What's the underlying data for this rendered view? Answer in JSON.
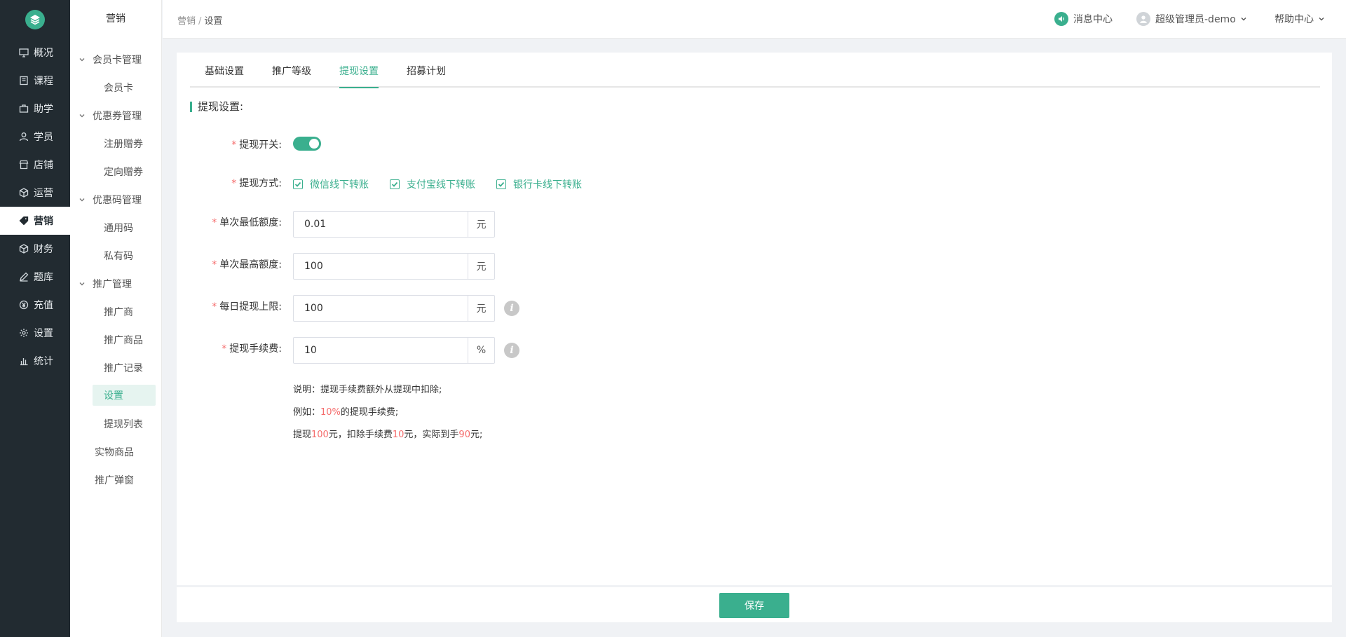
{
  "rail": {
    "items": [
      {
        "label": "概况",
        "icon": "monitor-icon"
      },
      {
        "label": "课程",
        "icon": "book-icon"
      },
      {
        "label": "助学",
        "icon": "briefcase-icon"
      },
      {
        "label": "学员",
        "icon": "user-icon"
      },
      {
        "label": "店铺",
        "icon": "store-icon"
      },
      {
        "label": "运营",
        "icon": "cube-icon"
      },
      {
        "label": "营销",
        "icon": "tag-icon",
        "active": true
      },
      {
        "label": "财务",
        "icon": "cube-icon"
      },
      {
        "label": "题库",
        "icon": "pen-icon"
      },
      {
        "label": "充值",
        "icon": "yen-icon"
      },
      {
        "label": "设置",
        "icon": "gear-icon"
      },
      {
        "label": "统计",
        "icon": "bar-chart-icon"
      }
    ]
  },
  "sidebar": {
    "title": "营销",
    "groups": [
      {
        "label": "会员卡管理",
        "items": [
          "会员卡"
        ]
      },
      {
        "label": "优惠券管理",
        "items": [
          "注册赠券",
          "定向赠券"
        ]
      },
      {
        "label": "优惠码管理",
        "items": [
          "通用码",
          "私有码"
        ]
      },
      {
        "label": "推广管理",
        "items": [
          "推广商",
          "推广商品",
          "推广记录",
          "设置",
          "提现列表"
        ]
      }
    ],
    "plain": [
      "实物商品",
      "推广弹窗"
    ]
  },
  "header": {
    "breadcrumb": [
      "营销",
      "设置"
    ],
    "messages": "消息中心",
    "user": "超级管理员-demo",
    "help": "帮助中心"
  },
  "tabs": [
    "基础设置",
    "推广等级",
    "提现设置",
    "招募计划"
  ],
  "active_tab": "提现设置",
  "form": {
    "section_title": "提现设置:",
    "switch_label": "提现开关:",
    "switch_on": true,
    "method_label": "提现方式:",
    "methods": [
      "微信线下转账",
      "支付宝线下转账",
      "银行卡线下转账"
    ],
    "min_label": "单次最低额度:",
    "min_value": "0.01",
    "min_unit": "元",
    "max_label": "单次最高额度:",
    "max_value": "100",
    "max_unit": "元",
    "daily_label": "每日提现上限:",
    "daily_value": "100",
    "daily_unit": "元",
    "fee_label": "提现手续费:",
    "fee_value": "10",
    "fee_unit": "%"
  },
  "notes": {
    "line1": "说明：提现手续费额外从提现中扣除;",
    "line2_prefix": "例如：",
    "line2_red": "10%",
    "line2_suffix": "的提现手续费;",
    "line3_a": "提现",
    "line3_b": "100",
    "line3_c": "元，扣除手续费",
    "line3_d": "10",
    "line3_e": "元，实际到手",
    "line3_f": "90",
    "line3_g": "元;"
  },
  "footer": {
    "save": "保存"
  },
  "colors": {
    "accent": "#3aaf8e",
    "rail_bg": "#222b31",
    "required": "#f56c6c"
  }
}
